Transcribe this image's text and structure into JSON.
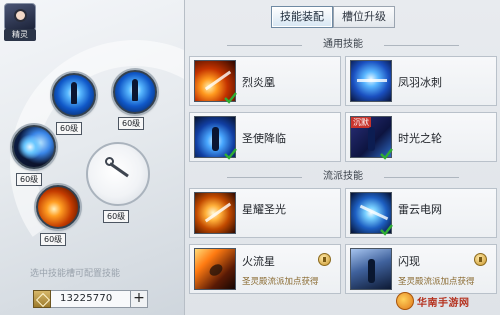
{
  "header": {
    "avatar_label": "精灵"
  },
  "tabs": [
    {
      "label": "技能装配",
      "active": true
    },
    {
      "label": "槽位升级",
      "active": false
    }
  ],
  "equipped_slots": [
    {
      "level": "60级",
      "effect": "blue-figure"
    },
    {
      "level": "60级",
      "effect": "blue-figure"
    },
    {
      "level": "60级",
      "effect": "lightning"
    },
    {
      "level": "60级",
      "effect": "fire"
    },
    {
      "level": "60级",
      "effect": "empty-clock"
    }
  ],
  "hint": "选中技能槽可配置技能",
  "currency": {
    "value": "13225770",
    "add_label": "+"
  },
  "sections": {
    "common": {
      "title": "通用技能",
      "skills": [
        {
          "name": "烈炎凰",
          "icon": "fire-phoenix-icon",
          "equipped": true
        },
        {
          "name": "凤羽冰刺",
          "icon": "blue-phoenix-icon",
          "equipped": false
        },
        {
          "name": "圣使降临",
          "icon": "holy-descent-icon",
          "equipped": true
        },
        {
          "name": "时光之轮",
          "icon": "time-wheel-icon",
          "badge": "沉默",
          "equipped": true
        }
      ]
    },
    "school": {
      "title": "流派技能",
      "skills": [
        {
          "name": "星耀圣光",
          "icon": "star-light-icon",
          "equipped": false
        },
        {
          "name": "雷云电网",
          "icon": "thunder-net-icon",
          "equipped": true
        },
        {
          "name": "火流星",
          "sub": "圣灵殿流派加点获得",
          "icon": "fire-meteor-icon",
          "locked": true
        },
        {
          "name": "闪现",
          "sub": "圣灵殿流派加点获得",
          "icon": "flash-icon",
          "locked": true
        }
      ]
    }
  },
  "watermark": "华南手游网",
  "colors": {
    "check_green": "#2fae33",
    "active_tab_border": "#6f8aa3",
    "locked_text": "#8a6b32"
  }
}
